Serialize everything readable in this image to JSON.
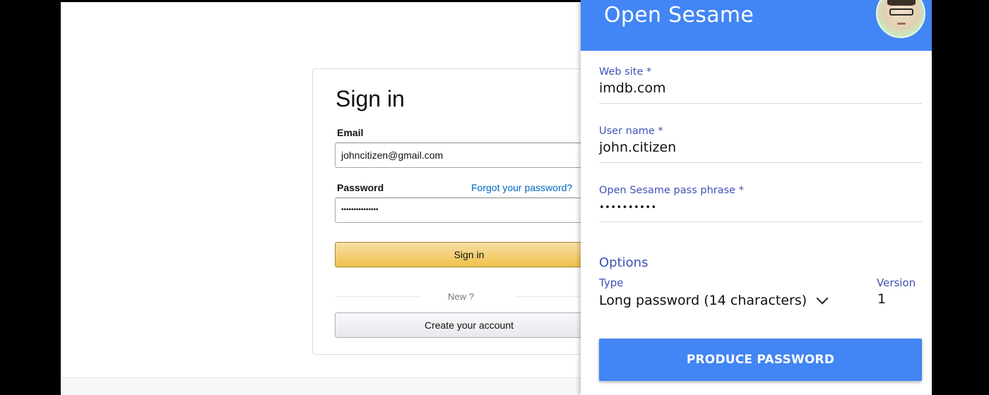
{
  "signin": {
    "title": "Sign in",
    "email_label": "Email",
    "email_value": "johncitizen@gmail.com",
    "password_label": "Password",
    "forgot_link": "Forgot your password?",
    "password_masked": "•••••••••••••••",
    "signin_button": "Sign in",
    "divider_text": "New ?",
    "create_button": "Create your account"
  },
  "popup": {
    "title": "Open Sesame",
    "avatar_icon": "user-avatar",
    "fields": {
      "website_label": "Web site *",
      "website_value": "imdb.com",
      "username_label": "User name *",
      "username_value": "john.citizen",
      "passphrase_label": "Open Sesame pass phrase *",
      "passphrase_masked": "••••••••••"
    },
    "options": {
      "title": "Options",
      "type_label": "Type",
      "type_value": "Long password (14 characters)",
      "version_label": "Version",
      "version_value": "1"
    },
    "produce_button": "PRODUCE PASSWORD",
    "colors": {
      "header": "#4285f4",
      "label": "#3f51b5",
      "button": "#4285f4"
    }
  }
}
